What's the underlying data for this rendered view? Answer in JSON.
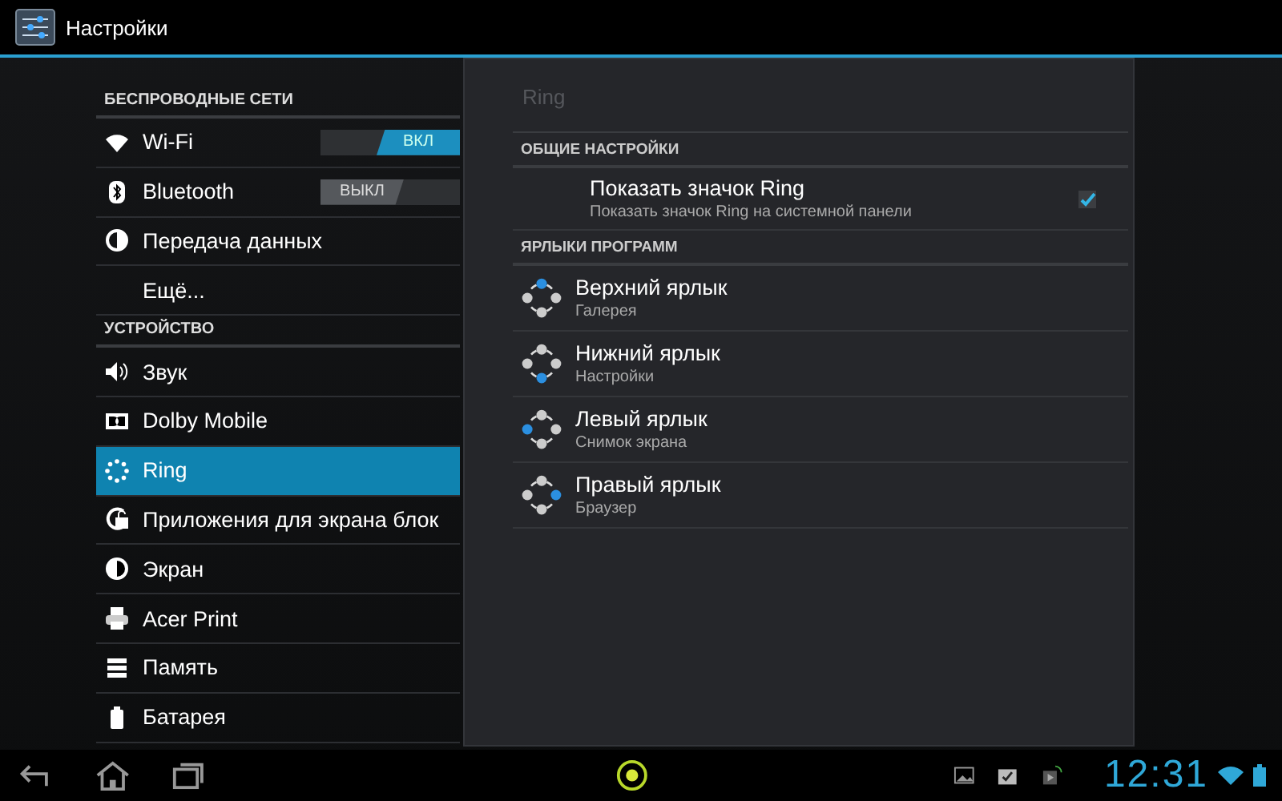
{
  "action_bar": {
    "title": "Настройки"
  },
  "sidebar": {
    "sections": [
      {
        "header": "БЕСПРОВОДНЫЕ СЕТИ",
        "items": [
          {
            "label": "Wi-Fi",
            "kind": "toggle",
            "selected": false,
            "on": true,
            "toggle_label": "ВКЛ"
          },
          {
            "label": "Bluetooth",
            "kind": "toggle",
            "selected": false,
            "on": false,
            "toggle_label": "ВЫКЛ"
          },
          {
            "label": "Передача данных",
            "kind": "plain",
            "selected": false
          },
          {
            "label": "Ещё...",
            "kind": "plain",
            "selected": false
          }
        ]
      },
      {
        "header": "УСТРОЙСТВО",
        "items": [
          {
            "label": "Звук",
            "kind": "plain",
            "selected": false
          },
          {
            "label": "Dolby Mobile",
            "kind": "plain",
            "selected": false
          },
          {
            "label": "Ring",
            "kind": "plain",
            "selected": true
          },
          {
            "label": "Приложения для экрана блок",
            "kind": "plain",
            "selected": false
          },
          {
            "label": "Экран",
            "kind": "plain",
            "selected": false
          },
          {
            "label": "Acer Print",
            "kind": "plain",
            "selected": false
          },
          {
            "label": "Память",
            "kind": "plain",
            "selected": false
          },
          {
            "label": "Батарея",
            "kind": "plain",
            "selected": false
          }
        ]
      }
    ]
  },
  "detail": {
    "title": "Ring",
    "general": {
      "header": "ОБЩИЕ НАСТРОЙКИ",
      "title": "Показать значок Ring",
      "summary": "Показать значок Ring на системной панели",
      "checked": true
    },
    "shortcuts": {
      "header": "ЯРЛЫКИ ПРОГРАММ",
      "items": [
        {
          "title": "Верхний ярлык",
          "summary": "Галерея",
          "kind": "top"
        },
        {
          "title": "Нижний ярлык",
          "summary": "Настройки",
          "kind": "bottom"
        },
        {
          "title": "Левый ярлык",
          "summary": "Снимок экрана",
          "kind": "left"
        },
        {
          "title": "Правый ярлык",
          "summary": "Браузер",
          "kind": "right"
        }
      ]
    }
  },
  "status_bar": {
    "time": "12:31"
  }
}
